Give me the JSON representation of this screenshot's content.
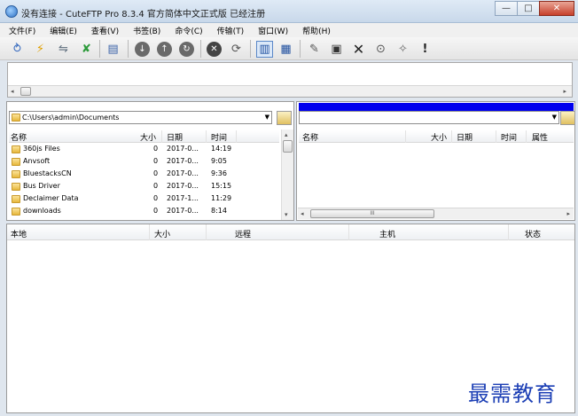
{
  "window": {
    "title": "没有连接 - CuteFTP Pro 8.3.4  官方简体中文正式版  已经注册",
    "minimize": "—",
    "maximize": "□",
    "close": "✕"
  },
  "menu": [
    "文件(F)",
    "编辑(E)",
    "查看(V)",
    "书签(B)",
    "命令(C)",
    "传输(T)",
    "窗口(W)",
    "帮助(H)"
  ],
  "toolbar": {
    "icons": [
      "connect-wizard-icon",
      "quick-connect-icon",
      "connect-icon",
      "disconnect-icon",
      "site-manager-icon",
      "download-icon",
      "upload-icon",
      "reconnect-icon",
      "stop-icon",
      "refresh-icon",
      "view-icon",
      "detail-view-icon",
      "edit-icon",
      "terminal-icon",
      "delete-icon",
      "find-icon",
      "new-file-icon",
      "alert-icon"
    ]
  },
  "local": {
    "path": "C:\\Users\\admin\\Documents",
    "columns": [
      "名称",
      "大小",
      "日期",
      "时间"
    ],
    "files": [
      {
        "name": "360js Files",
        "size": "0",
        "date": "2017-0...",
        "time": "14:19"
      },
      {
        "name": "Anvsoft",
        "size": "0",
        "date": "2017-0...",
        "time": "9:05"
      },
      {
        "name": "BluestacksCN",
        "size": "0",
        "date": "2017-0...",
        "time": "9:36"
      },
      {
        "name": "Bus Driver",
        "size": "0",
        "date": "2017-0...",
        "time": "15:15"
      },
      {
        "name": "Declaimer Data",
        "size": "0",
        "date": "2017-1...",
        "time": "11:29"
      },
      {
        "name": "downloads",
        "size": "0",
        "date": "2017-0...",
        "time": "8:14"
      }
    ]
  },
  "remote": {
    "path": "",
    "columns": [
      "名称",
      "大小",
      "日期",
      "时间",
      "属性"
    ],
    "scroll_grip": "III"
  },
  "queue": {
    "columns": [
      "本地",
      "大小",
      "远程",
      "主机",
      "状态"
    ]
  },
  "watermark": "最需教育",
  "colors": {
    "accent_blue": "#0000ee",
    "watermark": "#1c3fb5",
    "panel_bg": "#dfe6ee"
  }
}
